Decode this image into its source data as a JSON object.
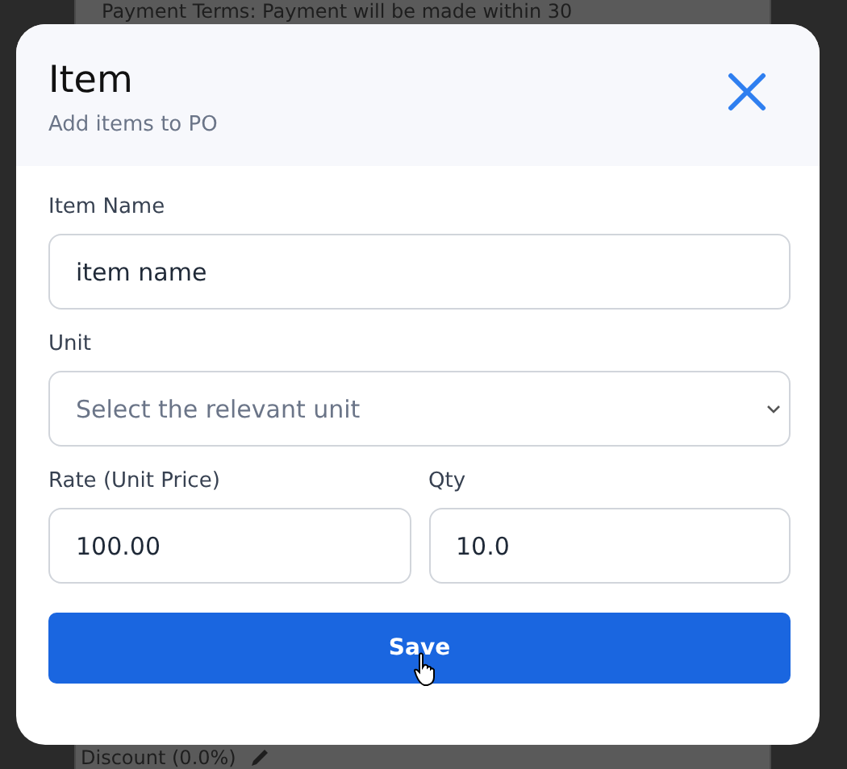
{
  "background": {
    "top_text": "Payment Terms: Payment will be made within 30",
    "bottom_text": "Discount (0.0%)"
  },
  "dialog": {
    "title": "Item",
    "subtitle": "Add items to PO",
    "fields": [
      {
        "kind": "text",
        "label": "Item Name",
        "value": "item name"
      },
      {
        "kind": "select",
        "label": "Unit",
        "placeholder": "Select the relevant unit"
      },
      {
        "kind": "pair",
        "fields": [
          {
            "kind": "text",
            "label": "Rate (Unit Price)",
            "value": "100.00"
          },
          {
            "kind": "text",
            "label": "Qty",
            "value": "10.0"
          }
        ]
      }
    ],
    "button": "Save"
  }
}
